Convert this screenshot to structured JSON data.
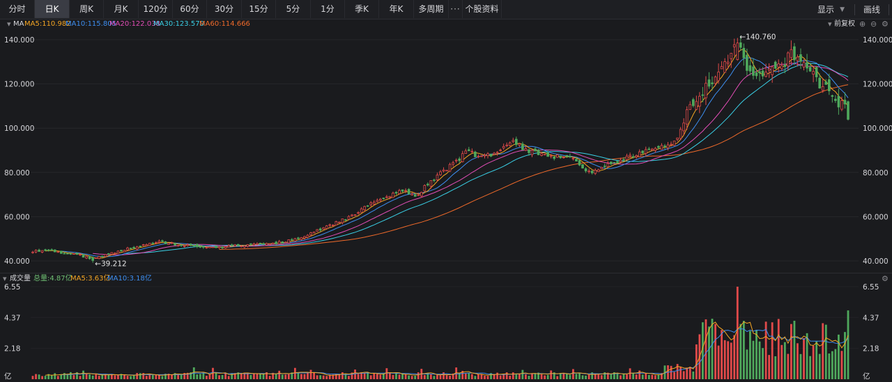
{
  "toolbar": {
    "tabs": [
      "分时",
      "日K",
      "周K",
      "月K",
      "120分",
      "60分",
      "30分",
      "15分",
      "5分",
      "1分",
      "季K",
      "年K",
      "多周期",
      "···",
      "个股资料"
    ],
    "active_tab": "日K",
    "display_label": "显示",
    "draw_label": "画线"
  },
  "price_panel": {
    "indicator": "MA",
    "ma": [
      {
        "label": "MA5:110.982",
        "color": "#f5a623"
      },
      {
        "label": "MA10:115.805",
        "color": "#3d8ef0"
      },
      {
        "label": "MA20:122.038",
        "color": "#e34db6"
      },
      {
        "label": "MA30:123.570",
        "color": "#3ad0e6"
      },
      {
        "label": "MA60:114.666",
        "color": "#f06a2a"
      }
    ],
    "adjust_label": "前复权",
    "y_ticks": [
      "140.000",
      "120.000",
      "100.000",
      "80.000",
      "60.000",
      "40.000"
    ],
    "high_label": "140.760",
    "low_label": "39.212"
  },
  "volume_panel": {
    "title": "成交量",
    "total_label": "总量:4.87亿",
    "ma5_label": "MA5:3.63亿",
    "ma10_label": "MA10:3.18亿",
    "y_ticks": [
      "6.55",
      "4.37",
      "2.18"
    ],
    "unit": "亿"
  },
  "colors": {
    "up": "#e24a4a",
    "down": "#4fa85c",
    "ma5": "#f5a623",
    "ma10": "#3d8ef0",
    "ma20": "#e34db6",
    "ma30": "#3ad0e6",
    "ma60": "#f06a2a"
  },
  "chart_data": {
    "type": "candlestick",
    "period": "daily",
    "ylim": [
      38,
      145
    ],
    "y_ticks": [
      140,
      120,
      100,
      80,
      60,
      40
    ],
    "max_price": 140.76,
    "min_price": 39.212,
    "close_trajectory": [
      [
        0,
        44.5
      ],
      [
        5,
        44.8
      ],
      [
        10,
        43.5
      ],
      [
        15,
        42.5
      ],
      [
        19,
        41.0
      ],
      [
        22,
        42.0
      ],
      [
        28,
        44.8
      ],
      [
        35,
        47.0
      ],
      [
        40,
        48.5
      ],
      [
        45,
        47.5
      ],
      [
        52,
        46.5
      ],
      [
        58,
        46.0
      ],
      [
        65,
        47.0
      ],
      [
        72,
        47.5
      ],
      [
        78,
        48.3
      ],
      [
        82,
        49.5
      ],
      [
        86,
        51.5
      ],
      [
        90,
        53.8
      ],
      [
        94,
        56.0
      ],
      [
        98,
        58.5
      ],
      [
        102,
        61.0
      ],
      [
        106,
        65.0
      ],
      [
        110,
        67.5
      ],
      [
        114,
        70.5
      ],
      [
        118,
        72.0
      ],
      [
        121,
        68.5
      ],
      [
        125,
        75.0
      ],
      [
        129,
        79.5
      ],
      [
        132,
        83.0
      ],
      [
        135,
        86.0
      ],
      [
        137,
        90.5
      ],
      [
        141,
        87.0
      ],
      [
        145,
        88.0
      ],
      [
        149,
        91.0
      ],
      [
        152,
        94.5
      ],
      [
        156,
        90.0
      ],
      [
        160,
        88.5
      ],
      [
        164,
        87.0
      ],
      [
        169,
        87.5
      ],
      [
        172,
        85.0
      ],
      [
        176,
        80.0
      ],
      [
        180,
        82.5
      ],
      [
        184,
        84.5
      ],
      [
        188,
        86.5
      ],
      [
        192,
        88.5
      ],
      [
        196,
        90.5
      ],
      [
        200,
        92.5
      ],
      [
        204,
        95.0
      ],
      [
        207,
        106.0
      ],
      [
        209,
        111.0
      ],
      [
        212,
        116.0
      ],
      [
        215,
        121.0
      ],
      [
        218,
        126.0
      ],
      [
        221,
        131.0
      ],
      [
        223,
        138.0
      ],
      [
        226,
        128.0
      ],
      [
        229,
        124.0
      ],
      [
        232,
        126.0
      ],
      [
        235,
        128.0
      ],
      [
        238,
        130.0
      ],
      [
        240,
        134.0
      ],
      [
        243,
        128.0
      ],
      [
        246,
        124.0
      ],
      [
        249,
        120.0
      ],
      [
        252,
        116.0
      ],
      [
        255,
        112.0
      ],
      [
        257,
        109.0
      ],
      [
        258,
        104.5
      ]
    ],
    "volume_peak": 6.55,
    "volume_ticks": [
      6.55,
      4.37,
      2.18
    ]
  }
}
